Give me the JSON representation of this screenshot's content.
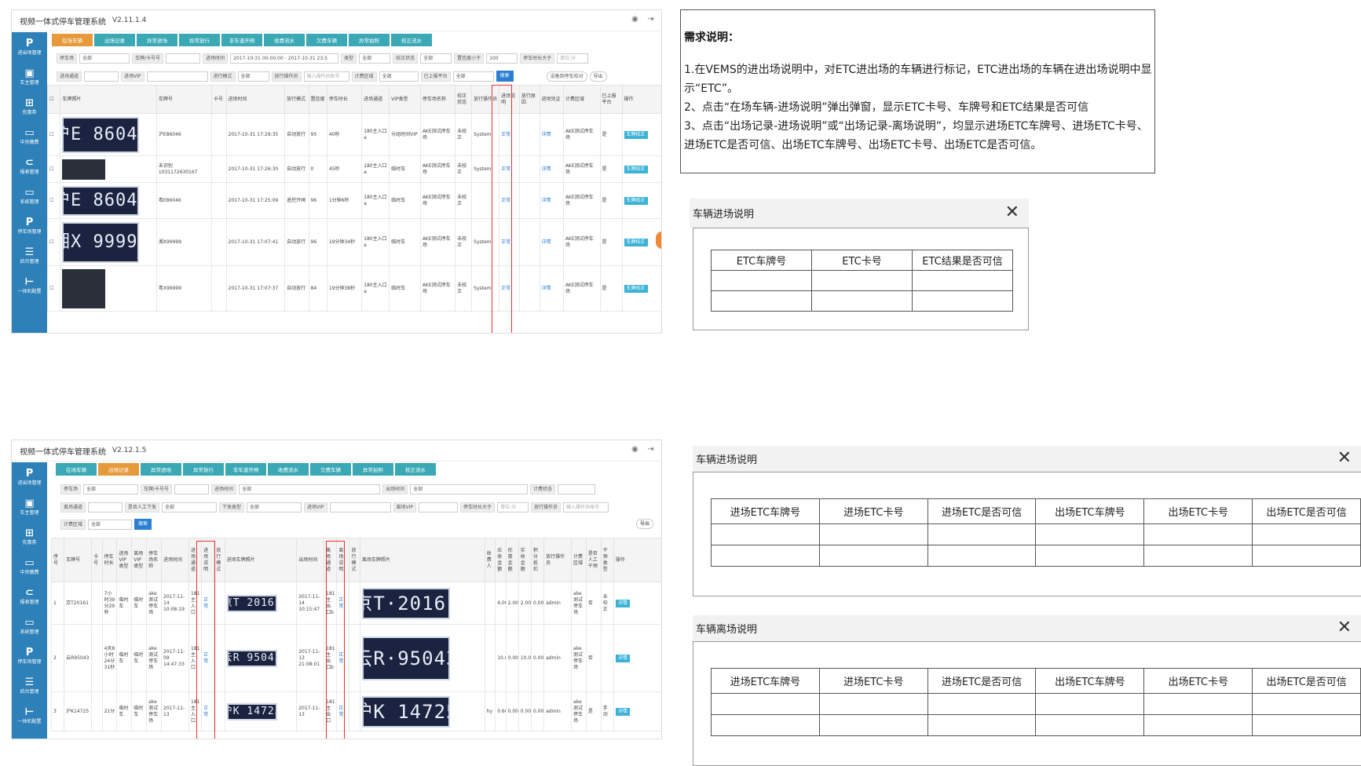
{
  "app1": {
    "title": "视频一体式停车管理系统",
    "version": "V2.11.1.4",
    "sidebar": [
      "进出场管理",
      "车主管理",
      "优惠券",
      "中央缴费",
      "报表管理",
      "系统管理",
      "停车场管理",
      "后台管理",
      "一体机配置"
    ],
    "tabs": [
      "在场车辆",
      "出场记录",
      "异常进场",
      "异常放行",
      "非车道开闸",
      "收费流水",
      "欠费车辆",
      "异常拍照",
      "校正流水"
    ],
    "filters1": {
      "lot_label": "停车场",
      "lot_value": "全部",
      "plate_label": "车牌/卡号号",
      "time_label": "进场时间",
      "time_value": "2017-10-31 00:00:00 - 2017-10-31 23:5",
      "type_label": "类型",
      "type_value": "全部",
      "calib_label": "校正状态",
      "calib_value": "全部",
      "conf_label": "置信度小于",
      "conf_value": "100",
      "dur_label": "停车时长大于",
      "dur_placeholder": "单位:分"
    },
    "filters2": {
      "channel_label": "进场通道",
      "vip_label": "进场VIP",
      "release_label": "进行模式",
      "release_value": "全部",
      "operator_label": "放行操作员",
      "operator_placeholder": "输入操作员账号",
      "billing_label": "计费区域",
      "billing_value": "全部",
      "uploaded_label": "已上报平台",
      "uploaded_value": "全部",
      "search_btn": "搜索",
      "mark_btn": "设备到停车校对",
      "export_btn": "导出"
    },
    "headers": [
      "车牌照片",
      "车牌号",
      "卡号",
      "进场时间",
      "放行模式",
      "置信度",
      "停车时长",
      "进场通道",
      "VIP类型",
      "停车场名称",
      "校正状态",
      "放行操作员",
      "进场说明",
      "放行原因",
      "进场凭证",
      "计费区域",
      "已上报平台",
      "操作"
    ],
    "rows": [
      {
        "plate_img": "沪E 86046",
        "plate": "沪E86046",
        "card": "",
        "time": "2017-10-31 17:29:35",
        "mode": "自动放行",
        "conf": "95",
        "dur": "40秒",
        "channel": "180主入口a",
        "vip": "分组时间VIP",
        "lot": "AKE测试停车场",
        "calib": "未校正",
        "op": "System",
        "note": "正常",
        "reason": "",
        "voucher": "详情",
        "area": "AKE测试停车场",
        "uploaded": "是",
        "action": "车牌校正"
      },
      {
        "plate_img": "",
        "plate": "未识别 1031172630167",
        "card": "",
        "time": "2017-10-31 17:26:30",
        "mode": "自动放行",
        "conf": "0",
        "dur": "45秒",
        "channel": "180主入口a",
        "vip": "临时车",
        "lot": "AKE测试停车场",
        "calib": "未校正",
        "op": "System",
        "note": "正常",
        "reason": "",
        "voucher": "详情",
        "area": "AKE测试停车场",
        "uploaded": "是",
        "action": "车牌校正"
      },
      {
        "plate_img": "沪E 86046",
        "plate": "粤E86046",
        "card": "",
        "time": "2017-10-31 17:25:09",
        "mode": "遥控开闸",
        "conf": "96",
        "dur": "1分钟6秒",
        "channel": "180主入口a",
        "vip": "临时车",
        "lot": "AKE测试停车场",
        "calib": "未校正",
        "op": "",
        "note": "正常",
        "reason": "",
        "voucher": "详情",
        "area": "AKE测试停车场",
        "uploaded": "是",
        "action": "车牌校正"
      },
      {
        "plate_img": "湘X 99999",
        "plate": "湘X99999",
        "card": "",
        "time": "2017-10-31 17:07:41",
        "mode": "自动放行",
        "conf": "96",
        "dur": "19分钟34秒",
        "channel": "180主入口a",
        "vip": "临时车",
        "lot": "AKE测试停车场",
        "calib": "未校正",
        "op": "System",
        "note": "正常",
        "reason": "",
        "voucher": "详情",
        "area": "AKE测试停车场",
        "uploaded": "是",
        "action": "车牌校正"
      },
      {
        "plate_img": "",
        "plate": "粤X99999",
        "card": "",
        "time": "2017-10-31 17:07:37",
        "mode": "自动放行",
        "conf": "84",
        "dur": "19分钟38秒",
        "channel": "180主入口a",
        "vip": "临时车",
        "lot": "AKE测试停车场",
        "calib": "未校正",
        "op": "System",
        "note": "正常",
        "reason": "",
        "voucher": "详情",
        "area": "AKE测试停车场",
        "uploaded": "是",
        "action": "车牌校正"
      }
    ]
  },
  "app2": {
    "title": "视频一体式停车管理系统",
    "version": "V2.12.1.5",
    "sidebar": [
      "进出场管理",
      "车主管理",
      "优惠券",
      "中央缴费",
      "报表管理",
      "系统管理",
      "停车场管理",
      "后台管理",
      "一体机配置"
    ],
    "tabs": [
      "在场车辆",
      "出场记录",
      "异常进场",
      "异常放行",
      "非车道开闸",
      "收费流水",
      "欠费车辆",
      "异常拍照",
      "校正流水"
    ],
    "filters1": {
      "lot_label": "停车场",
      "lot_value": "全部",
      "plate_label": "车牌/卡号号",
      "entry_label": "进场时间",
      "entry_value": "全部",
      "exit_label": "出场时间",
      "exit_value": "全部",
      "paid_label": "计费状态"
    },
    "filters2": {
      "channel_label": "离场通道",
      "manual_label": "是否人工下发",
      "manual_value": "全部",
      "issue_label": "下发类型",
      "issue_value": "全部",
      "vip_in_label": "进场VIP",
      "vip_out_label": "离场VIP",
      "dur_label": "停车时长大于",
      "dur_placeholder": "单位:分",
      "op_label": "放行操作员",
      "op_placeholder": "输入操作员账号"
    },
    "filters3": {
      "area_label": "计费区域",
      "area_value": "全部",
      "search_btn": "搜索",
      "export_btn": "导出"
    },
    "headers": [
      "序号",
      "车牌号",
      "卡号",
      "停车时长",
      "进场VIP类型",
      "离场VIP类型",
      "停车场名称",
      "进场时间",
      "进场通道",
      "进场说明",
      "放行模式",
      "进场车牌照片",
      "出场时间",
      "离场通道",
      "离场说明",
      "放行模式",
      "离场车牌照片",
      "收费人",
      "应收金额",
      "优惠金额",
      "实收金额",
      "积分抵扣",
      "放行操作员",
      "计费区域",
      "是否人工干预",
      "干预类型",
      "操作"
    ],
    "rows": [
      {
        "no": "1",
        "plate": "京T20161",
        "card": "",
        "dur": "7小时39分29秒",
        "vin": "临时车",
        "vout": "临时车",
        "lot": "ake测试停车场",
        "tin": "2017-11-14 10:08:19",
        "chin": "181主入口",
        "nin": "正常",
        "imgin": "京T 20161",
        "tout": "2017-11-14 10:15:47",
        "chout": "181主出口b",
        "nout": "正常",
        "imgout": "京T·20161",
        "payer": "",
        "due": "4.00",
        "disc": "2.00",
        "paid": "2.00",
        "points": "0.00",
        "op": "admin",
        "area": "ake测试停车场",
        "manual": "否",
        "itype": "未校正",
        "action": "详情"
      },
      {
        "no": "2",
        "plate": "云R95043",
        "card": "",
        "dur": "4天8小时24分31秒",
        "vin": "临时车",
        "vout": "临时车",
        "lot": "ake测试停车场",
        "tin": "2017-11-09 14:47:33",
        "chin": "181主入口",
        "nin": "正常",
        "imgin": "云R 95043",
        "tout": "2017-11-13 21:08:01",
        "chout": "181主出口b",
        "nout": "正常",
        "imgout": "云R·95043",
        "payer": "",
        "due": "10.00",
        "disc": "0.00",
        "paid": "10.00",
        "points": "0.00",
        "op": "admin",
        "area": "ake测试停车场",
        "manual": "否",
        "itype": "",
        "action": "详情"
      },
      {
        "no": "3",
        "plate": "沪K14725",
        "card": "",
        "dur": "21分",
        "vin": "临时车",
        "vout": "临时车",
        "lot": "ake测试停车场",
        "tin": "2017-11-13",
        "chin": "181主入口",
        "nin": "正常",
        "imgin": "沪K 14725",
        "tout": "2017-11-13",
        "chout": "181主出口",
        "nout": "正常",
        "imgout": "沪K 14725",
        "payer": "hy",
        "due": "0.60",
        "disc": "0.00",
        "paid": "0.00",
        "points": "0.00",
        "op": "admin",
        "area": "ake测试停车场",
        "manual": "是",
        "itype": "手动",
        "action": "详情"
      }
    ]
  },
  "requirements": {
    "title": "需求说明：",
    "items": [
      "1.在VEMS的进出场说明中，对ETC进出场的车辆进行标记，ETC进出场的车辆在进出场说明中显示“ETC”。",
      "2、点击“在场车辆-进场说明”弹出弹窗，显示ETC卡号、车牌号和ETC结果是否可信",
      "3、点击“出场记录-进场说明”或“出场记录-离场说明”，均显示进场ETC车牌号、进场ETC卡号、进场ETC是否可信、出场ETC车牌号、出场ETC卡号、出场ETC是否可信。"
    ]
  },
  "dialog_entry1": {
    "title": "车辆进场说明",
    "close": "✕",
    "headers": [
      "ETC车牌号",
      "ETC卡号",
      "ETC结果是否可信"
    ]
  },
  "dialog_entry2": {
    "title": "车辆进场说明",
    "close": "✕",
    "headers": [
      "进场ETC车牌号",
      "进场ETC卡号",
      "进场ETC是否可信",
      "出场ETC车牌号",
      "出场ETC卡号",
      "出场ETC是否可信"
    ]
  },
  "dialog_exit": {
    "title": "车辆离场说明",
    "close": "✕",
    "headers": [
      "进场ETC车牌号",
      "进场ETC卡号",
      "进场ETC是否可信",
      "出场ETC车牌号",
      "出场ETC卡号",
      "出场ETC是否可信"
    ]
  },
  "colors": {
    "sidebar": "#2d80b8",
    "tab": "#3aa9b5",
    "tab_active": "#e79a3b",
    "highlight": "#e53333",
    "link": "#2b7fd1"
  }
}
